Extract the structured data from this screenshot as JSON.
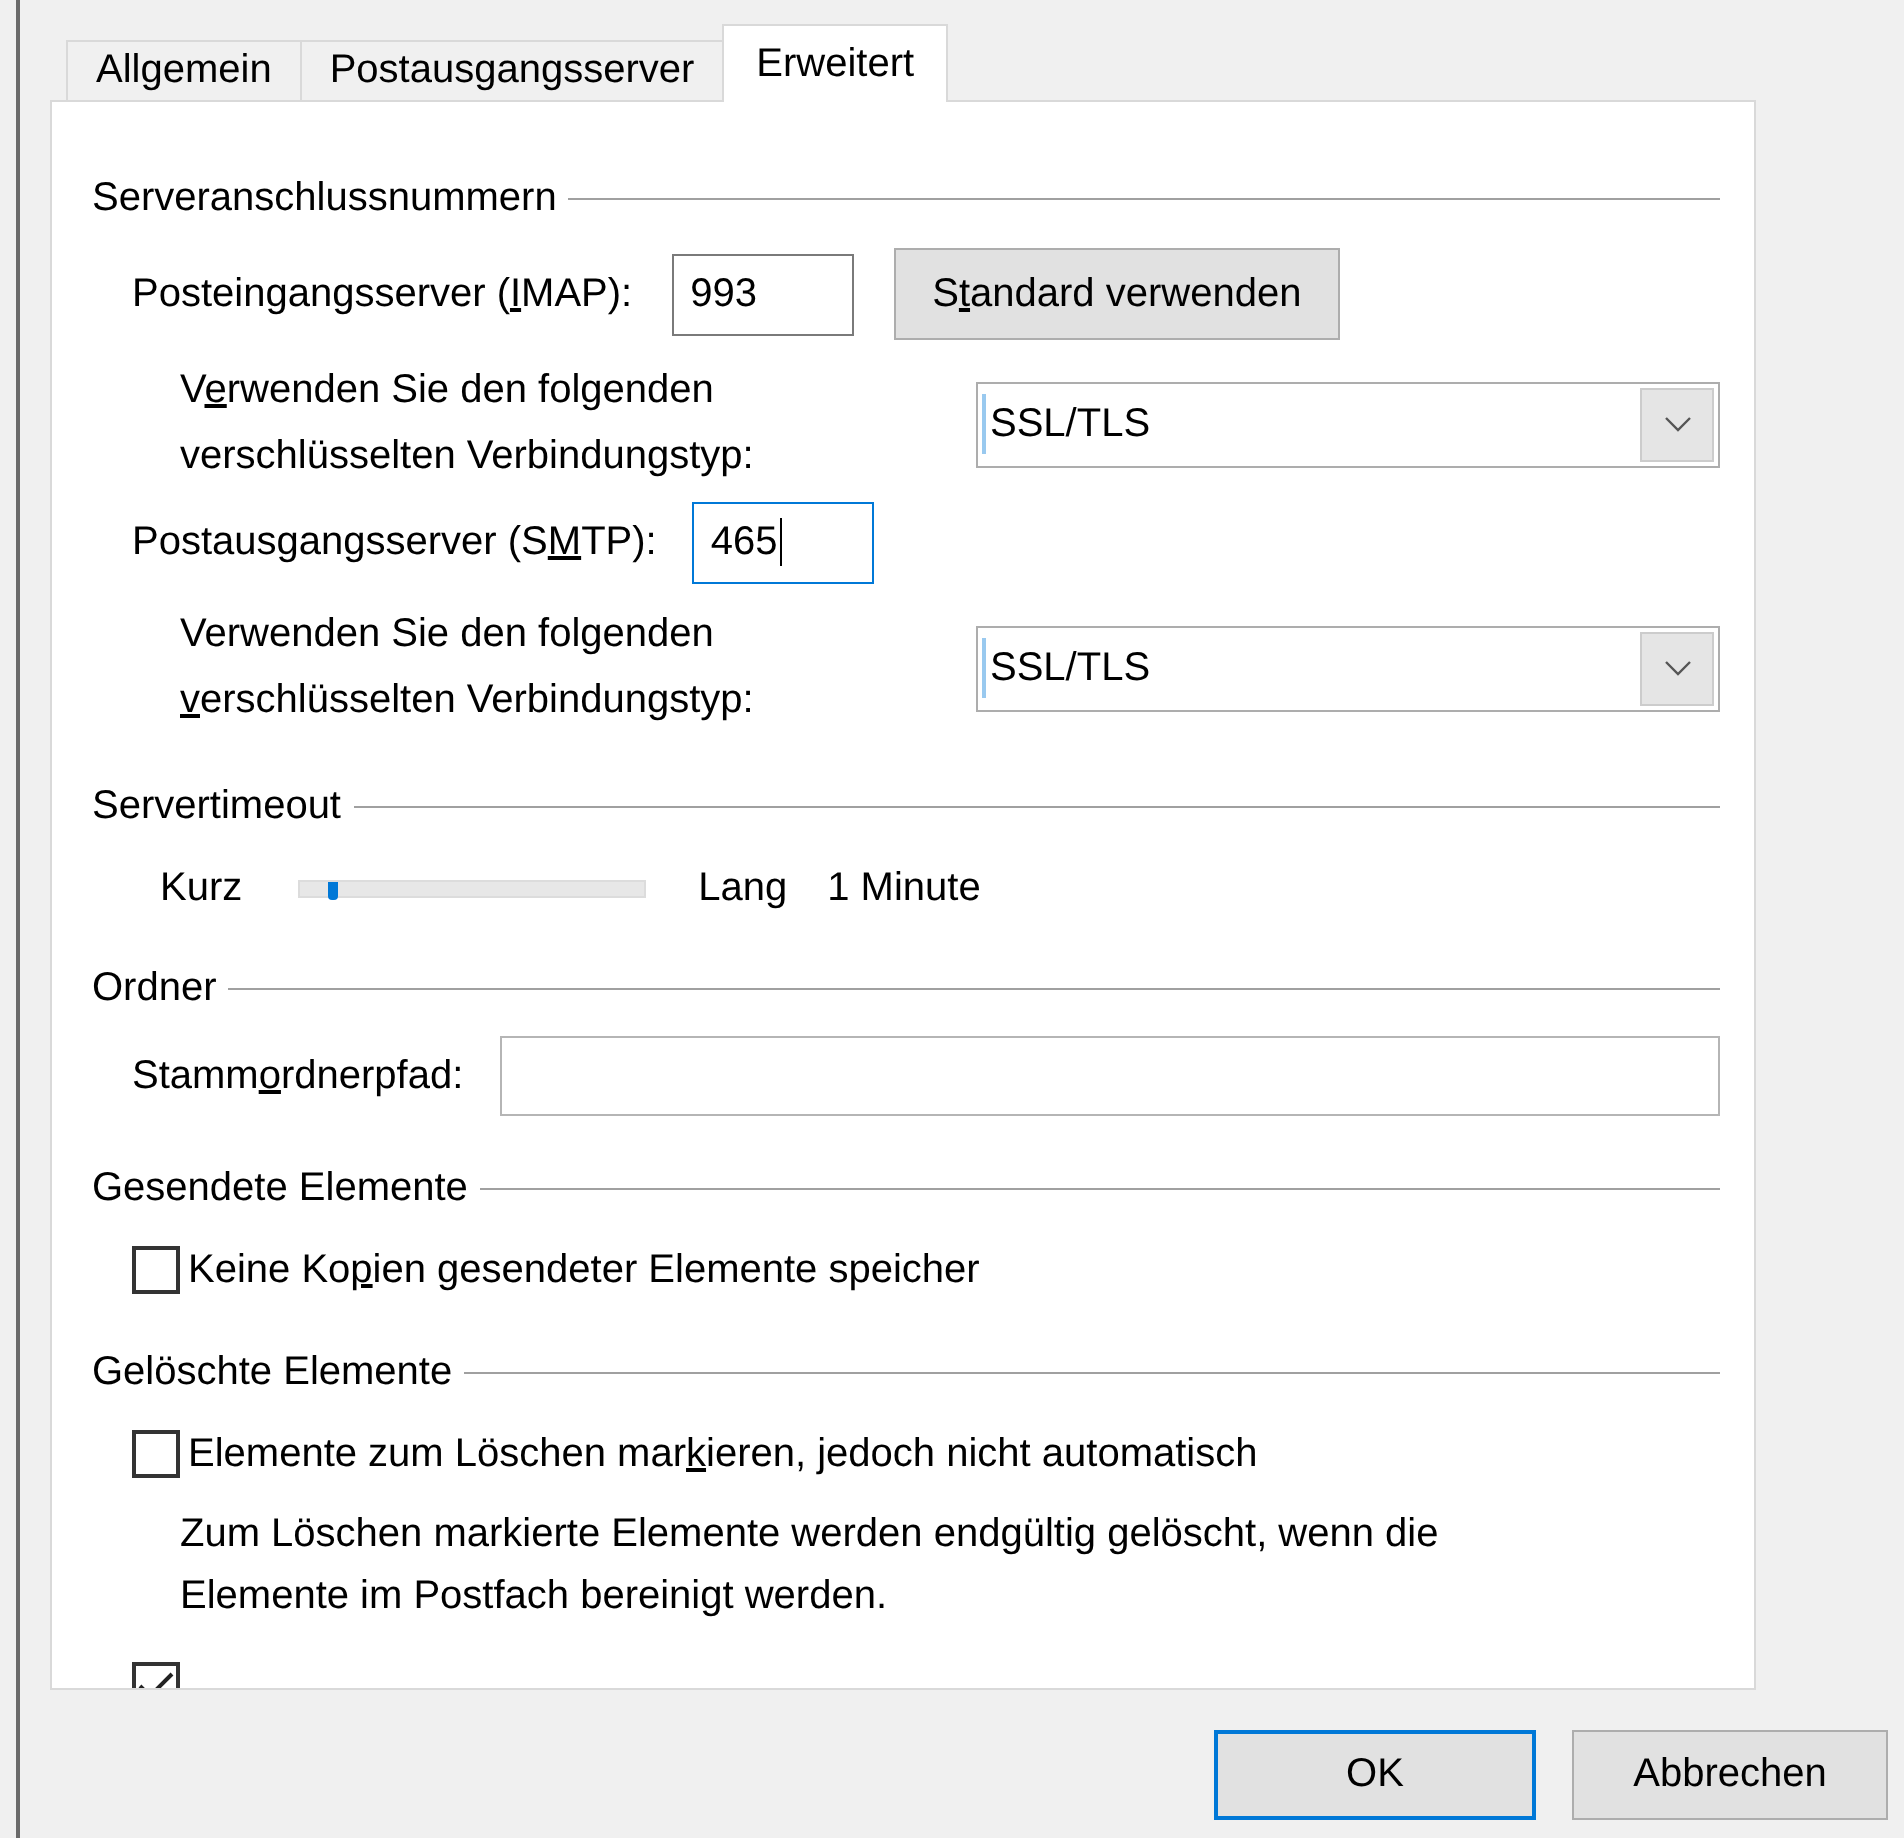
{
  "tabs": [
    {
      "label": "Allgemein",
      "selected": false
    },
    {
      "label": "Postausgangsserver",
      "selected": false
    },
    {
      "label": "Erweitert",
      "selected": true
    }
  ],
  "sections": [
    {
      "title": "Serveranschlussnummern",
      "rows": [
        {
          "kind": "port",
          "label": [
            "Posteingangsserver (",
            "I",
            "MAP):"
          ],
          "value": "993",
          "focused": false,
          "button": [
            "S",
            "t",
            "andard verwenden"
          ]
        },
        {
          "kind": "select",
          "label": [
            "V",
            "e",
            "rwenden Sie den folgenden\nverschlüsselten Verbindungstyp:"
          ],
          "value": "SSL/TLS"
        },
        {
          "kind": "port",
          "label": [
            "Postausgangsserver (S",
            "M",
            "TP):"
          ],
          "value": "465",
          "focused": true
        },
        {
          "kind": "select",
          "label": [
            "Verwenden Sie den folgenden\n",
            "v",
            "erschlüsselten Verbindungstyp:"
          ],
          "value": "SSL/TLS"
        }
      ]
    },
    {
      "title": "Servertimeout",
      "rows": [
        {
          "kind": "slider",
          "min_label": "Kurz",
          "max_label": "Lang",
          "level": 0.08,
          "reading": "1 Minute"
        }
      ]
    },
    {
      "title": "Ordner",
      "rows": [
        {
          "kind": "text",
          "label": [
            "Stamm",
            "o",
            "rdnerpfad:"
          ]
        }
      ]
    },
    {
      "title": "Gesendete Elemente",
      "rows": [
        {
          "kind": "checkbox",
          "label": [
            "Keine Ko",
            "p",
            "ien gesendeter Elemente speicher"
          ],
          "checked": false
        }
      ]
    },
    {
      "title": "Gelöschte Elemente",
      "rows": [
        {
          "kind": "checkbox",
          "label": [
            "Elemente zum Löschen mar",
            "k",
            "ieren, jedoch nicht automatisch"
          ],
          "checked": false
        },
        {
          "kind": "note",
          "text": "Zum Löschen markierte Elemente werden endgültig gelöscht, wenn die\nElemente im Postfach bereinigt werden."
        },
        {
          "kind": "checkbox",
          "checked": true
        }
      ]
    }
  ],
  "buttons": [
    {
      "label": "OK",
      "default": true
    },
    {
      "label": "Abbrechen",
      "default": false
    }
  ]
}
